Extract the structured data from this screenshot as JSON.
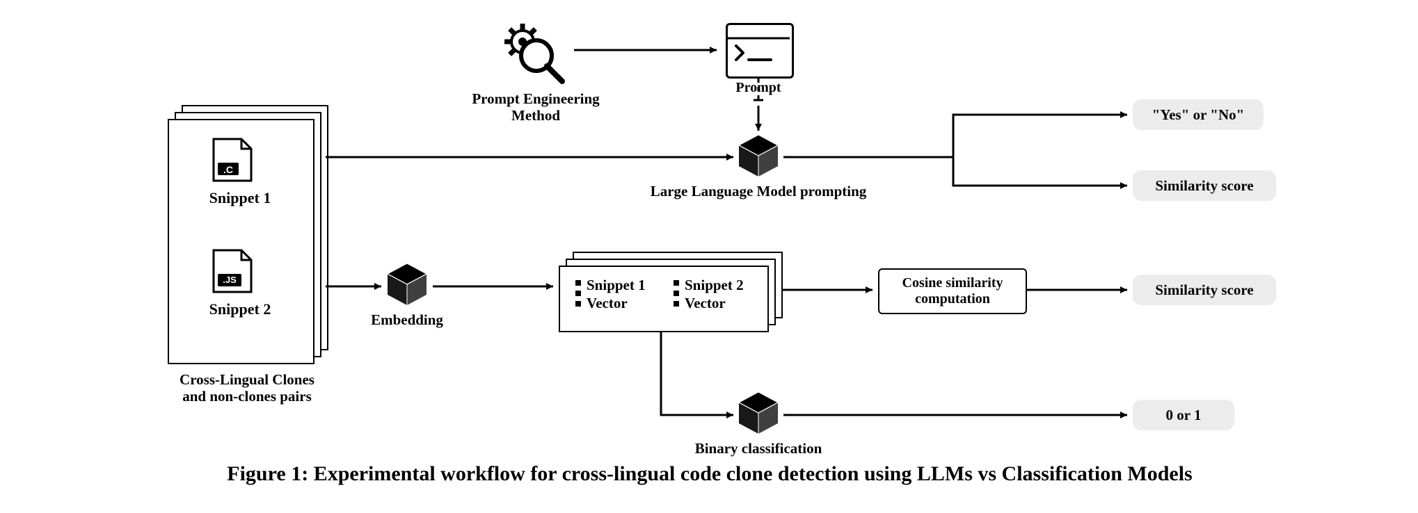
{
  "figure_caption": "Figure 1: Experimental workflow for cross-lingual code clone detection using LLMs vs Classification Models",
  "input": {
    "snippet1_label": "Snippet 1",
    "snippet2_label": "Snippet 2",
    "snippet1_ext": ".C",
    "snippet2_ext": ".JS",
    "source_label": "Cross-Lingual Clones\nand non-clones pairs"
  },
  "top_path": {
    "prompt_engineering_label": "Prompt Engineering\nMethod",
    "prompt_label": "Prompt",
    "llm_label": "Large Language Model prompting"
  },
  "middle_path": {
    "embedding_label": "Embedding",
    "vec1_line1": "Snippet 1",
    "vec1_line2": "Vector",
    "vec2_line1": "Snippet 2",
    "vec2_line2": "Vector",
    "cosine_label": "Cosine similarity\ncomputation"
  },
  "bottom_path": {
    "binary_label": "Binary classification"
  },
  "outputs": {
    "yes_no": "\"Yes\" or \"No\"",
    "similarity_top": "Similarity score",
    "similarity_mid": "Similarity score",
    "binary_out": "0 or 1"
  }
}
